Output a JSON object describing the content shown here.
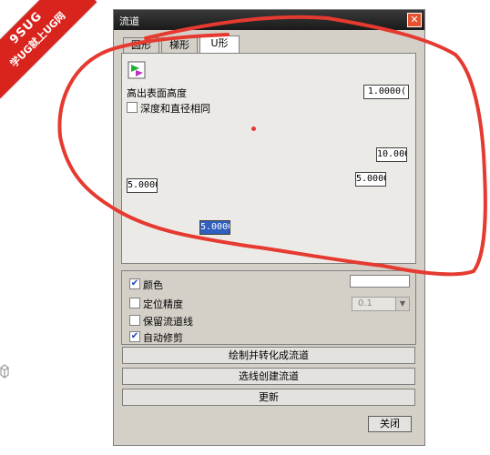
{
  "watermark": {
    "line1": "9SUG",
    "line2": "学UG就上UG网"
  },
  "dialog": {
    "title": "流道",
    "close_glyph": "✕",
    "tabs": [
      {
        "label": "圆形"
      },
      {
        "label": "梯形"
      },
      {
        "label": "U形",
        "active": true
      }
    ],
    "panel": {
      "height_label": "高出表面高度",
      "height_value": "1.0000(",
      "same_depth_label": "深度和直径相同",
      "same_depth_checked": false,
      "field_right_top": "10.000(",
      "field_right_mid": "5.0000(",
      "field_left": "5.0000(",
      "field_bottom": "5.0000("
    },
    "options": {
      "color_label": "颜色",
      "color_checked": true,
      "locate_label": "定位精度",
      "locate_checked": false,
      "locate_value": "0.1",
      "keep_lines_label": "保留流道线",
      "keep_lines_checked": false,
      "auto_trim_label": "自动修剪",
      "auto_trim_checked": true
    },
    "buttons": {
      "draw_convert": "绘制并转化成流道",
      "select_create": "选线创建流道",
      "update": "更新",
      "close": "关闭"
    }
  },
  "colors": {
    "annotation_red": "#e53a30",
    "selection_blue": "#2f5fbf",
    "check_blue": "#1a3fc8"
  }
}
